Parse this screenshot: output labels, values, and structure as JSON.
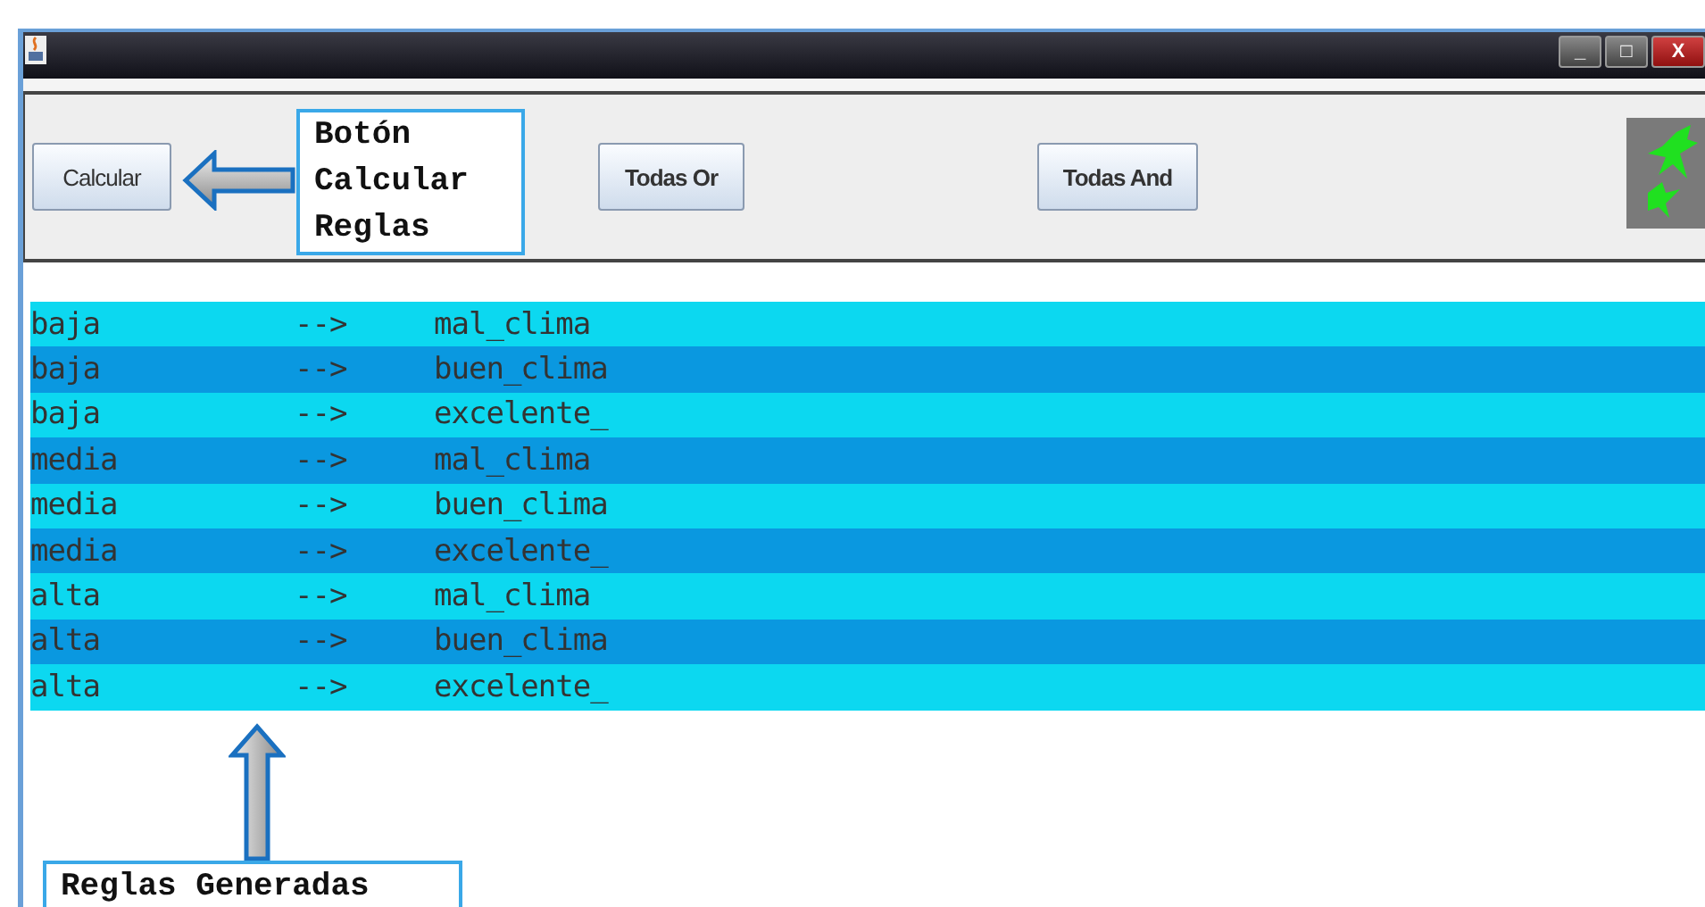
{
  "window": {
    "controls": [
      "_",
      "□",
      "X"
    ]
  },
  "toolbar": {
    "buttons": [
      {
        "label": "Calcular"
      },
      {
        "label": "Todas Or"
      },
      {
        "label": "Todas And"
      }
    ]
  },
  "rules": [
    {
      "antecedent": "baja",
      "arrow": "-->",
      "consequent": "mal_clima"
    },
    {
      "antecedent": "baja",
      "arrow": "-->",
      "consequent": "buen_clima"
    },
    {
      "antecedent": "baja",
      "arrow": "-->",
      "consequent": "excelente_"
    },
    {
      "antecedent": "media",
      "arrow": "-->",
      "consequent": "mal_clima"
    },
    {
      "antecedent": "media",
      "arrow": "-->",
      "consequent": "buen_clima"
    },
    {
      "antecedent": "media",
      "arrow": "-->",
      "consequent": "excelente_"
    },
    {
      "antecedent": "alta",
      "arrow": "-->",
      "consequent": "mal_clima"
    },
    {
      "antecedent": "alta",
      "arrow": "-->",
      "consequent": "buen_clima"
    },
    {
      "antecedent": "alta",
      "arrow": "-->",
      "consequent": "excelente_"
    }
  ],
  "callouts": [
    {
      "lines": [
        "Botón",
        "Calcular",
        "Reglas"
      ]
    },
    {
      "lines": [
        "Reglas Generadas"
      ]
    }
  ]
}
